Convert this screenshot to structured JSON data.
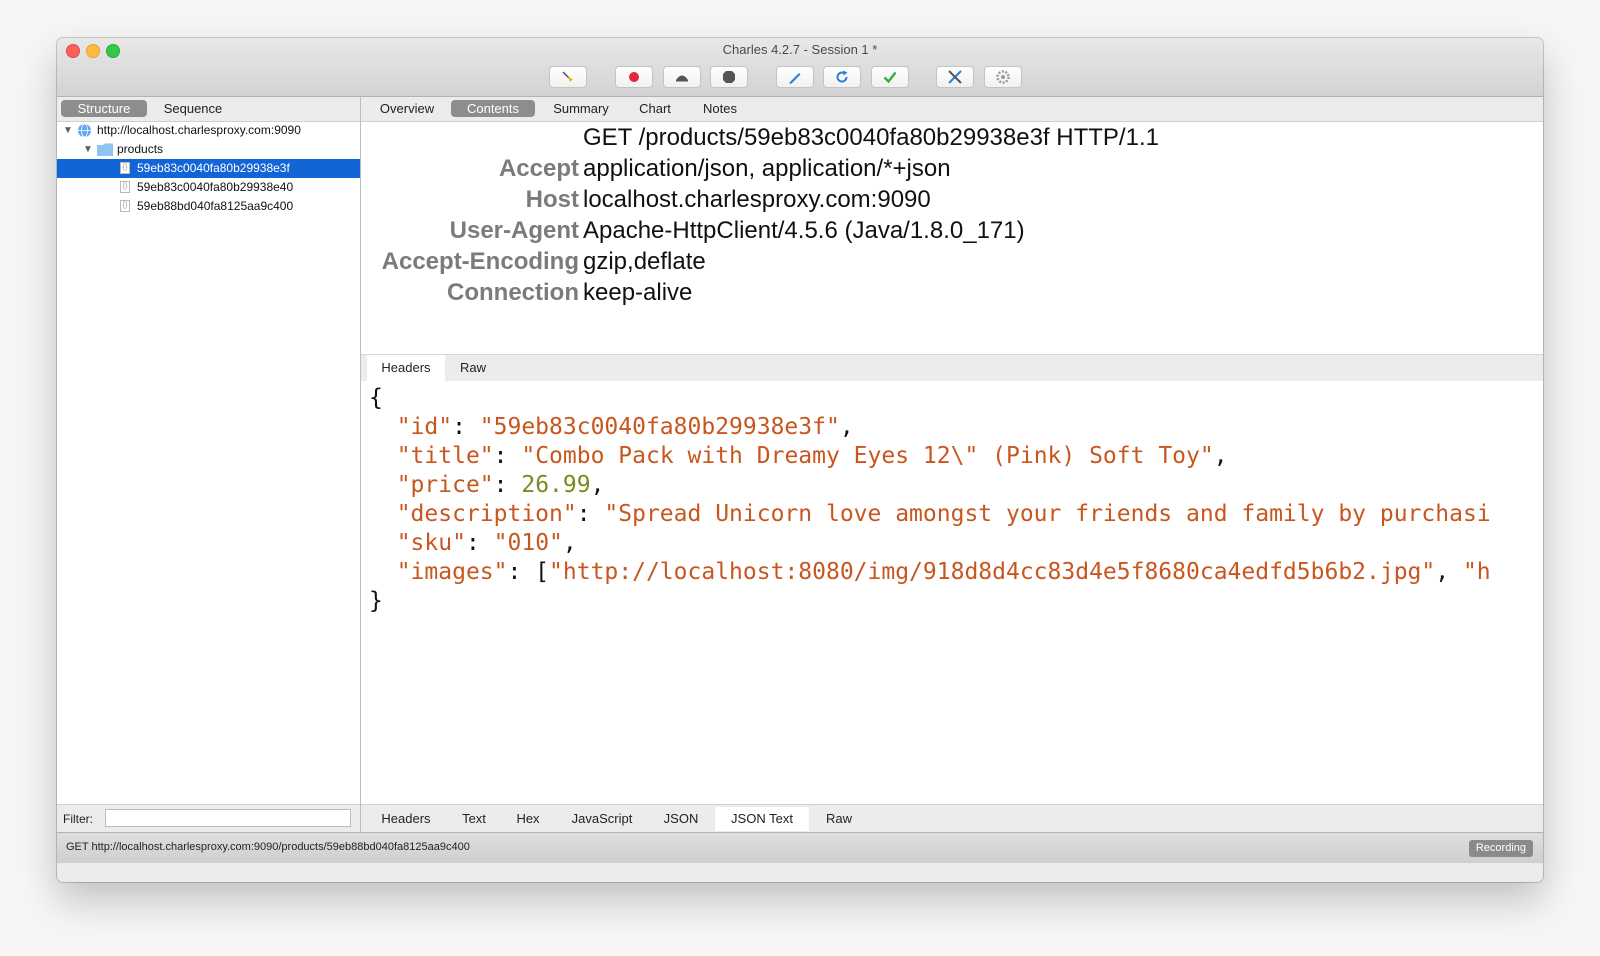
{
  "window": {
    "title": "Charles 4.2.7 - Session 1 *"
  },
  "toolbar": {
    "buttons": [
      {
        "icon": "broom-icon"
      },
      {
        "icon": "record-icon"
      },
      {
        "icon": "throttle-turtle-icon"
      },
      {
        "icon": "breakpoint-stop-icon"
      },
      {
        "icon": "compose-pen-icon"
      },
      {
        "icon": "repeat-refresh-icon"
      },
      {
        "icon": "validate-check-icon"
      },
      {
        "icon": "tools-icon"
      },
      {
        "icon": "settings-gear-icon"
      }
    ]
  },
  "left": {
    "tabs": {
      "structure": "Structure",
      "sequence": "Sequence"
    },
    "tree": {
      "host": "http://localhost.charlesproxy.com:9090",
      "folder": "products",
      "items": [
        "59eb83c0040fa80b29938e3f",
        "59eb83c0040fa80b29938e40",
        "59eb88bd040fa8125aa9c400"
      ]
    },
    "filter_label": "Filter:",
    "filter_value": ""
  },
  "right": {
    "tabs": {
      "overview": "Overview",
      "contents": "Contents",
      "summary": "Summary",
      "chart": "Chart",
      "notes": "Notes"
    },
    "request_line": "GET /products/59eb83c0040fa80b29938e3f HTTP/1.1",
    "headers": [
      {
        "name": "Accept",
        "value": "application/json, application/*+json"
      },
      {
        "name": "Host",
        "value": "localhost.charlesproxy.com:9090"
      },
      {
        "name": "User-Agent",
        "value": "Apache-HttpClient/4.5.6 (Java/1.8.0_171)"
      },
      {
        "name": "Accept-Encoding",
        "value": "gzip,deflate"
      },
      {
        "name": "Connection",
        "value": "keep-alive"
      }
    ],
    "request_tabs": {
      "headers": "Headers",
      "raw": "Raw"
    },
    "json": {
      "open": "{",
      "close": "}",
      "fields": {
        "id_key": "\"id\"",
        "id_val": "\"59eb83c0040fa80b29938e3f\"",
        "title_key": "\"title\"",
        "title_val": "\"Combo Pack with Dreamy Eyes 12\\\" (Pink) Soft Toy\"",
        "price_key": "\"price\"",
        "price_val": "26.99",
        "description_key": "\"description\"",
        "description_val": "\"Spread Unicorn love amongst your friends and family by purchasi",
        "sku_key": "\"sku\"",
        "sku_val": "\"010\"",
        "images_key": "\"images\"",
        "images_val": "\"http://localhost:8080/img/918d8d4cc83d4e5f8680ca4edfd5b6b2.jpg\"",
        "images_tail": "\"h"
      }
    },
    "response_tabs": {
      "headers": "Headers",
      "text": "Text",
      "hex": "Hex",
      "javascript": "JavaScript",
      "json": "JSON",
      "json_text": "JSON Text",
      "raw": "Raw"
    }
  },
  "status": {
    "text": "GET http://localhost.charlesproxy.com:9090/products/59eb88bd040fa8125aa9c400",
    "badge": "Recording"
  },
  "colors": {
    "selection": "#1265d6",
    "json_string": "#c8571f",
    "json_number": "#7b8a1e"
  }
}
